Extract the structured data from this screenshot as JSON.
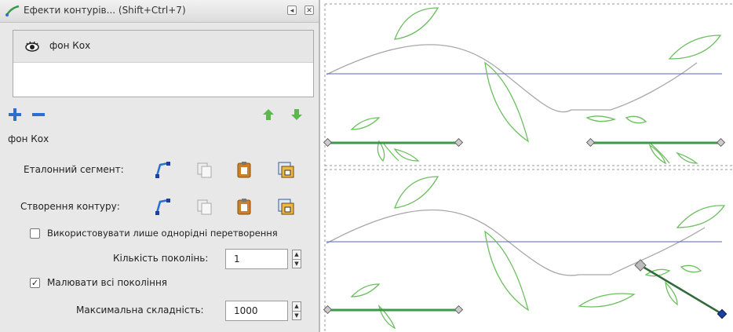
{
  "window": {
    "title": "Ефекти контурів... (Shift+Ctrl+7)",
    "btn_iconify": "◂",
    "btn_close": "✕"
  },
  "effects_list": {
    "items": [
      {
        "label": "фон Кох"
      }
    ]
  },
  "effect_name": "фон Кох",
  "reference_segment": {
    "label": "Еталонний сегмент:"
  },
  "path_generation": {
    "label": "Створення контуру:"
  },
  "uniform_transforms": {
    "label": "Використовувати лише однорідні перетворення",
    "checked": false
  },
  "generations": {
    "label": "Кількість поколінь:",
    "value": "1"
  },
  "draw_all_generations": {
    "label": "Малювати всі покоління",
    "checked": true,
    "mark": "✓"
  },
  "max_complexity": {
    "label": "Максимальна складність:",
    "value": "1000"
  },
  "spinner": {
    "up": "▲",
    "down": "▼"
  },
  "colors": {
    "add_button": "#2b6fd1",
    "remove_button": "#2b6fd1",
    "move_arrows": "#5cb84c",
    "path_green": "#3a9a4a",
    "guide_blue": "#5566bb",
    "curve_gray": "#a8a8a8",
    "leaf_green": "#6cbf5f",
    "node_selected": "#1f3fa0"
  }
}
